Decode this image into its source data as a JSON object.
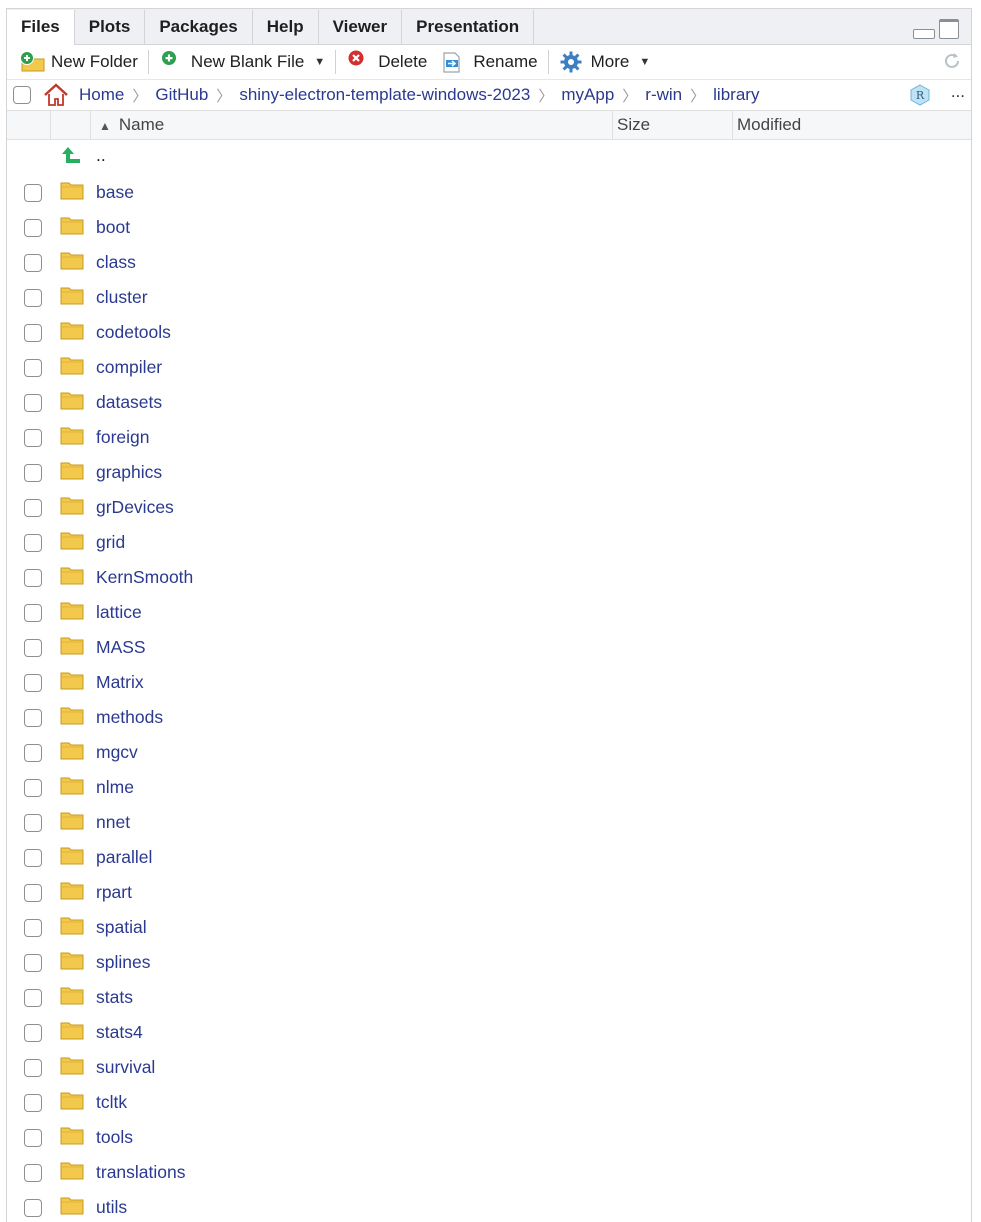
{
  "tabs": [
    "Files",
    "Plots",
    "Packages",
    "Help",
    "Viewer",
    "Presentation"
  ],
  "active_tab": "Files",
  "toolbar": {
    "new_folder": "New Folder",
    "new_blank_file": "New Blank File",
    "delete": "Delete",
    "rename": "Rename",
    "more": "More"
  },
  "breadcrumb": [
    "Home",
    "GitHub",
    "shiny-electron-template-windows-2023",
    "myApp",
    "r-win",
    "library"
  ],
  "breadcrumb_more": "...",
  "columns": {
    "name": "Name",
    "size": "Size",
    "modified": "Modified"
  },
  "parent_dir": "..",
  "files": [
    "base",
    "boot",
    "class",
    "cluster",
    "codetools",
    "compiler",
    "datasets",
    "foreign",
    "graphics",
    "grDevices",
    "grid",
    "KernSmooth",
    "lattice",
    "MASS",
    "Matrix",
    "methods",
    "mgcv",
    "nlme",
    "nnet",
    "parallel",
    "rpart",
    "spatial",
    "splines",
    "stats",
    "stats4",
    "survival",
    "tcltk",
    "tools",
    "translations",
    "utils"
  ],
  "icons": {
    "folder": "folder-icon",
    "up": "up-arrow-icon",
    "home": "home-icon"
  },
  "colors": {
    "link": "#2b3990",
    "folder": "#f2c94c",
    "delete": "#d32f2f",
    "add": "#2e9e4f"
  }
}
